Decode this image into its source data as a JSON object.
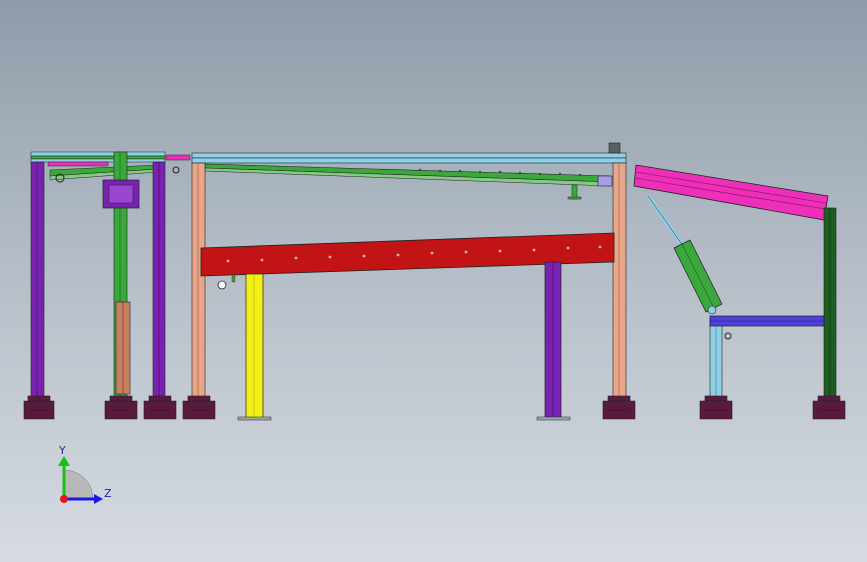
{
  "viewport": {
    "background_top": "#8e9ca9",
    "background_bottom": "#d6dbe2"
  },
  "model": {
    "parts": [
      "left-portal-frame",
      "incline-roller-conveyor",
      "red-side-beam",
      "yellow-support-post",
      "purple-support-post",
      "pink-tilting-conveyor",
      "pneumatic-cylinder",
      "blue-crossbar",
      "leveling-feet"
    ],
    "colors": {
      "purple": "#7a22b0",
      "green": "#3aa83a",
      "red": "#c21414",
      "yellow": "#f2ee18",
      "pink": "#ee2fb8",
      "blue": "#5040d8",
      "cyan": "#8fd0e6",
      "salmon": "#e8a68a",
      "foot": "#5a1a3e",
      "dark_green": "#1e5e20"
    }
  },
  "triad": {
    "y_label": "Y",
    "z_label": "Z",
    "y_color": "#18c018",
    "z_color": "#1a1ae6",
    "x_color": "#e01818"
  }
}
